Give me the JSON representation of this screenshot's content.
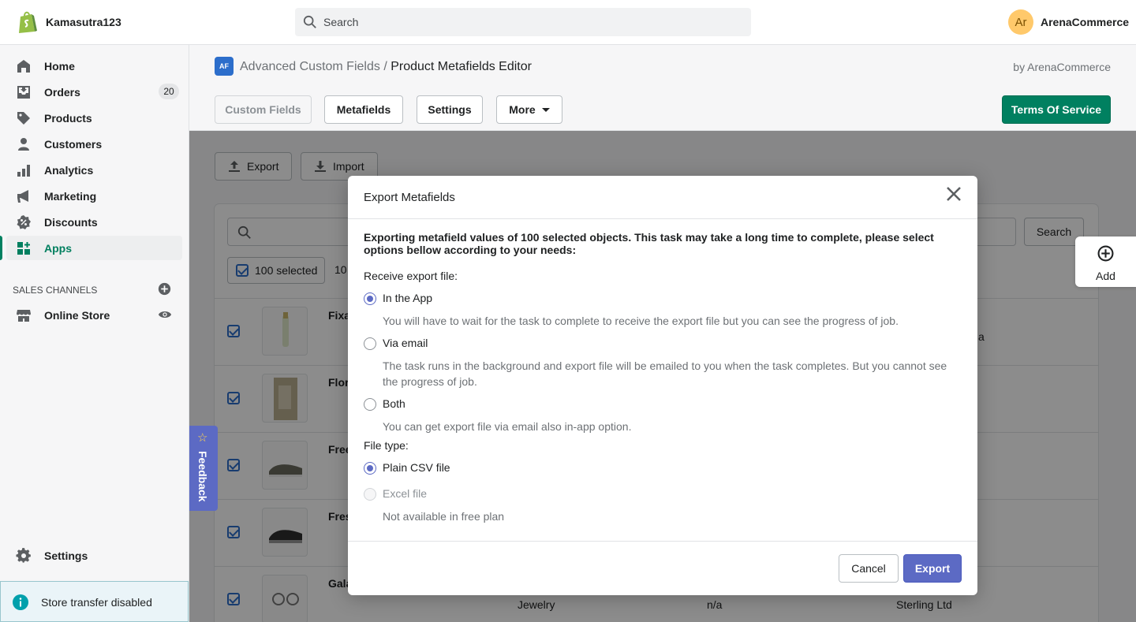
{
  "topbar": {
    "store_name": "Kamasutra123",
    "search_placeholder": "Search",
    "avatar_initials": "Ar",
    "user_name": "ArenaCommerce"
  },
  "sidebar": {
    "items": [
      {
        "label": "Home",
        "icon": "home-icon"
      },
      {
        "label": "Orders",
        "icon": "orders-icon",
        "badge": "20"
      },
      {
        "label": "Products",
        "icon": "tag-icon"
      },
      {
        "label": "Customers",
        "icon": "person-icon"
      },
      {
        "label": "Analytics",
        "icon": "bar-chart-icon"
      },
      {
        "label": "Marketing",
        "icon": "megaphone-icon"
      },
      {
        "label": "Discounts",
        "icon": "discount-icon"
      },
      {
        "label": "Apps",
        "icon": "apps-icon",
        "active": true
      }
    ],
    "sales_channels_title": "SALES CHANNELS",
    "online_store": "Online Store",
    "settings": "Settings",
    "store_transfer": "Store transfer disabled"
  },
  "app_header": {
    "crumb_parent": "Advanced Custom Fields",
    "crumb_sep": "/",
    "crumb_current": "Product Metafields Editor",
    "by": "by ArenaCommerce",
    "logo_text": "AF",
    "buttons": {
      "custom_fields": "Custom Fields",
      "metafields": "Metafields",
      "settings": "Settings",
      "more": "More",
      "terms": "Terms Of Service"
    }
  },
  "main": {
    "export": "Export",
    "import": "Import",
    "search_button": "Search",
    "selected": "100 selected",
    "selected_more": "10",
    "rows": [
      {
        "name": "Fixa",
        "c1": "",
        "c2": "",
        "c3": "a"
      },
      {
        "name": "Flor",
        "c1": "",
        "c2": "",
        "c3": ""
      },
      {
        "name": "Free",
        "c1": "",
        "c2": "",
        "c3": ""
      },
      {
        "name": "Fres",
        "c1": "",
        "c2": "",
        "c3": ""
      },
      {
        "name": "Gala",
        "c1": "Jewelry",
        "c2": "n/a",
        "c3": "Sterling Ltd"
      }
    ]
  },
  "add": "Add",
  "feedback": "Feedback",
  "modal": {
    "title": "Export Metafields",
    "intro": "Exporting metafield values of 100 selected objects. This task may take a long time to complete, please select options bellow according to your needs:",
    "receive_label": "Receive export file:",
    "options": [
      {
        "label": "In the App",
        "help": "You will have to wait for the task to complete to receive the export file but you can see the progress of job."
      },
      {
        "label": "Via email",
        "help": "The task runs in the background and export file will be emailed to you when the task completes. But you cannot see the progress of job."
      },
      {
        "label": "Both",
        "help": "You can get export file via email also in-app option."
      }
    ],
    "file_type_label": "File type:",
    "file_types": [
      {
        "label": "Plain CSV file"
      },
      {
        "label": "Excel file",
        "help": "Not available in free plan"
      }
    ],
    "cancel": "Cancel",
    "export": "Export"
  },
  "colors": {
    "accent": "#5c6ac4",
    "brand_green": "#008060",
    "shopify_logo": "#95bf47"
  }
}
